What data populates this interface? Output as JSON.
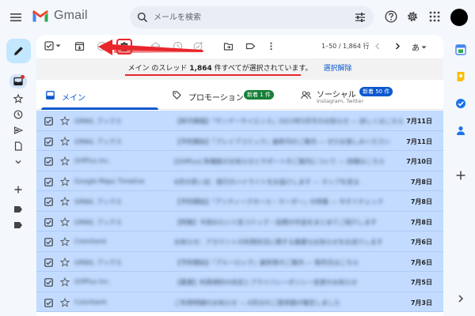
{
  "header": {
    "app_name": "Gmail",
    "search_placeholder": "メールを検索"
  },
  "toolbar": {
    "page_info": "1–50 / 1,864 行",
    "lang_label": "あ"
  },
  "banner": {
    "part1": "メイン のスレッド ",
    "count": "1,864",
    "part2": " 件すべてが選択されています。",
    "clear_link": "選択解除"
  },
  "tabs": [
    {
      "label": "メイン",
      "sub": "",
      "chip": ""
    },
    {
      "label": "プロモーション",
      "sub": "",
      "chip": "新着 1 件"
    },
    {
      "label": "ソーシャル",
      "sub": "Instagram, Twitter",
      "chip": "新着 50 件"
    }
  ],
  "emails": [
    {
      "sender": "GMAIL ブックス",
      "subject": "【新刊情報】『サンデーサイエンス』2023年5月号のお知らせ — 詳しくはこちら",
      "date": "7月11日"
    },
    {
      "sender": "GMAIL ブックス",
      "subject": "【予約開始】『ブレイブコミック』最新刊のご案内 — ぜひお楽しみください",
      "date": "7月11日"
    },
    {
      "sender": "GHPlus Inc.",
      "subject": "[GHPlus] 新機能のお知らせとサポートのご案内について — 詳細はこちら",
      "date": "7月10日"
    },
    {
      "sender": "Google Maps Timeline",
      "subject": "6月の思い出：旅行のハイライトをお届けします — マップを見る",
      "date": "7月8日"
    },
    {
      "sender": "GMAIL ブックス",
      "subject": "【予約開始】『アンティークホール・マーダー』の特集 — 今すぐチェック",
      "date": "7月8日"
    },
    {
      "sender": "GMAIL ブックス",
      "subject": "【特集】今読みたい人気コミック・話題の作品をまとめてご紹介します",
      "date": "7月8日"
    },
    {
      "sender": "Colorbank",
      "subject": "お知らせ：アカウントの利用状況に関する重要なお知らせをお送りします",
      "date": "7月6日"
    },
    {
      "sender": "GMAIL ブックス",
      "subject": "【予約開始】『ブルーロック』最新巻のご案内 — 発売日はこちら",
      "date": "7月6日"
    },
    {
      "sender": "GHPlus Inc.",
      "subject": "【重要】利用規約の改定とプライバシーポリシー変更のお知らせ",
      "date": "7月5日"
    },
    {
      "sender": "Colorbank",
      "subject": "ご利用明細のお知らせ — 6月分のご請求額が確定しました",
      "date": "7月3日"
    }
  ],
  "colors": {
    "selected_row": "#c2dbff",
    "accent_blue": "#0b57d0",
    "annotation_red": "#e8262b",
    "chip_green": "#188038",
    "chip_blue": "#0b57d0"
  }
}
